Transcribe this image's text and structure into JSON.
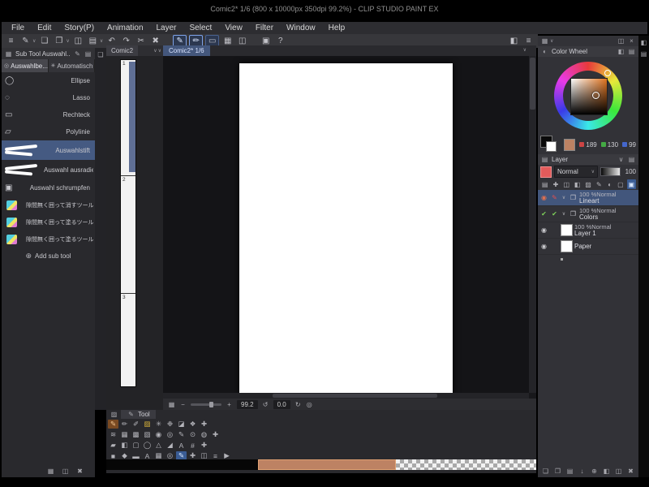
{
  "title_bar": {
    "title": "Comic2* 1/6 (800 x 10000px 350dpi 99.2%) - CLIP STUDIO PAINT EX"
  },
  "menus": [
    "File",
    "Edit",
    "Story(P)",
    "Animation",
    "Layer",
    "Select",
    "View",
    "Filter",
    "Window",
    "Help"
  ],
  "toolbar": {
    "icons": [
      {
        "n": "main-menu-icon",
        "g": "≡"
      },
      {
        "n": "tool-switch-icon",
        "g": "✎",
        "chev": true
      },
      {
        "n": "new-file-icon",
        "g": "❏"
      },
      {
        "n": "open-file-icon",
        "g": "❐",
        "chev": true
      },
      {
        "n": "save-icon",
        "g": "◫"
      },
      {
        "n": "export-icon",
        "g": "▤",
        "chev": true
      },
      {
        "n": "undo-icon",
        "g": "↶"
      },
      {
        "n": "redo-icon",
        "g": "↷"
      },
      {
        "n": "cut-icon",
        "g": "✂"
      },
      {
        "n": "delete-icon",
        "g": "✖"
      },
      {
        "sep": true
      },
      {
        "n": "selection-pen-mode-icon",
        "g": "✎",
        "frame": true,
        "active": true
      },
      {
        "n": "selection-erase-mode-icon",
        "g": "✏",
        "frame": true,
        "active": true
      },
      {
        "n": "selection-launcher-icon",
        "g": "▭",
        "frame": true
      },
      {
        "n": "snap-grid-icon",
        "g": "▦"
      },
      {
        "n": "panel-layout-icon",
        "g": "◫"
      },
      {
        "sep": true
      },
      {
        "n": "screen-mode-icon",
        "g": "▣"
      },
      {
        "n": "help-icon",
        "g": "?"
      }
    ],
    "right_icons": [
      {
        "n": "workspace-icon",
        "g": "◧"
      },
      {
        "n": "toolbar-overflow-icon",
        "g": "≡"
      }
    ]
  },
  "subtool": {
    "title": "Sub Tool Auswahl...",
    "header_icons": [
      {
        "n": "subtool-edit-icon",
        "g": "✎"
      },
      {
        "n": "subtool-menu-icon",
        "g": "▤"
      }
    ],
    "tabs": [
      {
        "label": "Auswahlbe...",
        "icon": "◎",
        "selected": true
      },
      {
        "label": "Automatisch",
        "icon": "✳",
        "selected": false
      }
    ],
    "items": [
      {
        "icon": "ellipse",
        "label": "Ellipse"
      },
      {
        "icon": "lasso",
        "label": "Lasso"
      },
      {
        "icon": "rect",
        "label": "Rechteck"
      },
      {
        "icon": "poly",
        "label": "Polylinie"
      },
      {
        "icon": "stroke",
        "label": "Auswahlstift",
        "selected": true
      },
      {
        "icon": "stroke",
        "label": "Auswahl ausradieren"
      },
      {
        "icon": "shrink",
        "label": "Auswahl schrumpfen"
      },
      {
        "icon": "chip",
        "label": "隙間無く囲って消すツール 参照"
      },
      {
        "icon": "chip",
        "label": "隙間無く囲って塗るツール 参照"
      },
      {
        "icon": "chip",
        "label": "隙間無く囲って塗るツール"
      }
    ],
    "add_label": "Add sub tool",
    "bottom_icons": [
      {
        "n": "pin-panel-icon",
        "g": "▦"
      },
      {
        "n": "duplicate-subtool-icon",
        "g": "◫"
      },
      {
        "n": "delete-subtool-icon",
        "g": "✖"
      }
    ]
  },
  "divider": {
    "icon": {
      "n": "page-manager-icon",
      "g": "❏"
    }
  },
  "pages": {
    "tab": "Comic2",
    "numbers": [
      "1",
      "2",
      "3"
    ]
  },
  "canvas": {
    "tab": "Comic2* 1/6",
    "zoom": "99.2",
    "rotation": "0.0"
  },
  "statusbar_icons": {
    "left": [
      {
        "n": "navigator-icon",
        "g": "▦"
      },
      {
        "n": "zoom-out-icon",
        "g": "−"
      }
    ],
    "mid": [
      {
        "n": "zoom-in-icon",
        "g": "+"
      }
    ],
    "right": [
      {
        "n": "rotate-left-icon",
        "g": "↺"
      }
    ],
    "end": [
      {
        "n": "rotate-right-icon",
        "g": "↻"
      },
      {
        "n": "reset-view-icon",
        "g": "◎"
      }
    ]
  },
  "tool_palette": {
    "tab": "Tool",
    "tab_icon": {
      "n": "tool-tab-pen-icon",
      "g": "✎"
    },
    "rows": [
      [
        {
          "n": "pen-tool-icon",
          "g": "✎",
          "sel": "orange"
        },
        {
          "n": "pencil-tool-icon",
          "g": "✏"
        },
        {
          "n": "brush-tool-icon",
          "g": "✐"
        },
        {
          "n": "fill-tool-icon",
          "g": "▨",
          "c": "#d8b33a"
        },
        {
          "n": "airbrush-tool-icon",
          "g": "✳"
        },
        {
          "n": "decoration-tool-icon",
          "g": "❉"
        },
        {
          "n": "eraser-tool-icon",
          "g": "◪"
        },
        {
          "n": "blend-tool-icon",
          "g": "❖"
        },
        {
          "n": "operation-tool-icon",
          "g": "✚"
        }
      ],
      [
        {
          "n": "gradient-tool-icon",
          "g": "≋"
        },
        {
          "n": "tone-tool-icon",
          "g": "▦"
        },
        {
          "n": "pattern-tool-icon",
          "g": "▩"
        },
        {
          "n": "hatch-tool-icon",
          "g": "▧"
        },
        {
          "n": "eyedropper-tool-icon",
          "g": "◉"
        },
        {
          "n": "circle-tool-icon",
          "g": "◎"
        },
        {
          "n": "correct-line-tool-icon",
          "g": "✎"
        },
        {
          "n": "focus-tool-icon",
          "g": "⊙"
        },
        {
          "n": "mix-tool-icon",
          "g": "◍"
        },
        {
          "n": "add-tool-icon",
          "g": "✚"
        }
      ],
      [
        {
          "n": "figure-tool-icon",
          "g": "▰"
        },
        {
          "n": "frame-border-tool-icon",
          "g": "◧"
        },
        {
          "n": "ruler-tool-icon",
          "g": "▢"
        },
        {
          "n": "ellipse-figure-tool-icon",
          "g": "◯"
        },
        {
          "n": "polygon-figure-tool-icon",
          "g": "△"
        },
        {
          "n": "corner-tool-icon",
          "g": "◢"
        },
        {
          "n": "text-tool-icon",
          "g": "A"
        },
        {
          "n": "grid-tool-icon",
          "g": "#"
        },
        {
          "n": "plus-tool-icon",
          "g": "✚"
        }
      ],
      [
        {
          "n": "fill-figure-tool-icon",
          "g": "■"
        },
        {
          "n": "diamond-tool-icon",
          "g": "◆"
        },
        {
          "n": "rect-figure-tool-icon",
          "g": "▬"
        },
        {
          "n": "text2-tool-icon",
          "g": "A"
        },
        {
          "n": "balloon-tool-icon",
          "g": "▦"
        },
        {
          "n": "target-tool-icon",
          "g": "◎"
        },
        {
          "n": "selection-pen-tool-icon",
          "g": "✎",
          "sel": "blue"
        },
        {
          "n": "move-tool-icon",
          "g": "✚"
        },
        {
          "n": "page-tool-icon",
          "g": "◫"
        },
        {
          "n": "lines-tool-icon",
          "g": "≡"
        },
        {
          "n": "play-tool-icon",
          "g": "▶"
        }
      ]
    ]
  },
  "color": {
    "panel_label": "Color Wheel",
    "current": "#bd8263",
    "accent_red": "#e25b5b",
    "sv_base": "#e07420",
    "values": [
      {
        "chip": "#cc4444",
        "v": "189"
      },
      {
        "chip": "#44aa44",
        "v": "130"
      },
      {
        "chip": "#4466cc",
        "v": "99"
      }
    ],
    "header_icons": [
      {
        "n": "color-wheel-mode-icon",
        "g": "◐"
      }
    ],
    "header_right_icons": [
      {
        "n": "color-prev-icon",
        "g": "◧"
      },
      {
        "n": "color-menu-icon",
        "g": "▤"
      }
    ]
  },
  "right_panel_top": {
    "left_icon": {
      "n": "panel-dock-menu-icon",
      "g": "▦"
    },
    "right_icons": [
      {
        "n": "collapse-panel-icon",
        "g": "◫"
      },
      {
        "n": "close-panel-icon",
        "g": "×"
      }
    ]
  },
  "layer_panel": {
    "title": "Layer",
    "title_icon": {
      "n": "layer-panel-icon",
      "g": "▤"
    },
    "header_right_icons": [
      {
        "n": "layer-panel-chevron-icon",
        "g": "∨"
      },
      {
        "n": "layer-panel-menu-icon",
        "g": "▤"
      }
    ],
    "blend": "Normal",
    "opacity": "100",
    "toolbar": [
      {
        "n": "layer-blend-icon",
        "g": "▤"
      },
      {
        "n": "layer-move-icon",
        "g": "✚"
      },
      {
        "n": "layer-clip-icon",
        "g": "◫"
      },
      {
        "n": "layer-lock-icon",
        "g": "◧"
      },
      {
        "n": "layer-lock-alpha-icon",
        "g": "▨"
      },
      {
        "n": "layer-draft-icon",
        "g": "✎"
      },
      {
        "n": "layer-mask-icon",
        "g": "◐"
      },
      {
        "n": "layer-ruler-icon",
        "g": "▢"
      },
      {
        "n": "layer-palette-icon",
        "g": "▣",
        "sel": "blue"
      }
    ],
    "rows": [
      {
        "eye": "◉",
        "eye_c": "#e07050",
        "mark": "✎",
        "mark_c": "#e05050",
        "expand": true,
        "folder": true,
        "line1": "100 %Normal",
        "line2": "Lineart",
        "selected": true
      },
      {
        "eye": "✔",
        "eye_c": "#7ed05a",
        "mark": "✔",
        "mark_c": "#7ed05a",
        "expand": true,
        "folder": true,
        "line1": "100 %Normal",
        "line2": "Colors"
      },
      {
        "eye": "◉",
        "eye_c": "#c8c8cc",
        "thumb": true,
        "line1": "100 %Normal",
        "line2": "Layer 1"
      },
      {
        "eye": "◉",
        "eye_c": "#c8c8cc",
        "thumb": true,
        "line2": "Paper"
      }
    ],
    "bottom_icons": [
      {
        "n": "new-layer-icon",
        "g": "❏"
      },
      {
        "n": "new-folder-icon",
        "g": "❐"
      },
      {
        "n": "paper-icon",
        "g": "▤"
      },
      {
        "n": "merge-down-icon",
        "g": "↓"
      },
      {
        "n": "combine-icon",
        "g": "⊕"
      },
      {
        "n": "layer-mask-create-icon",
        "g": "◧"
      },
      {
        "n": "two-pane-icon",
        "g": "◫"
      },
      {
        "n": "delete-layer-icon",
        "g": "✖"
      }
    ]
  },
  "right_strip_icons": [
    {
      "n": "material-panel-tab-icon",
      "g": "◧"
    },
    {
      "n": "history-panel-tab-icon",
      "g": "▤"
    }
  ]
}
